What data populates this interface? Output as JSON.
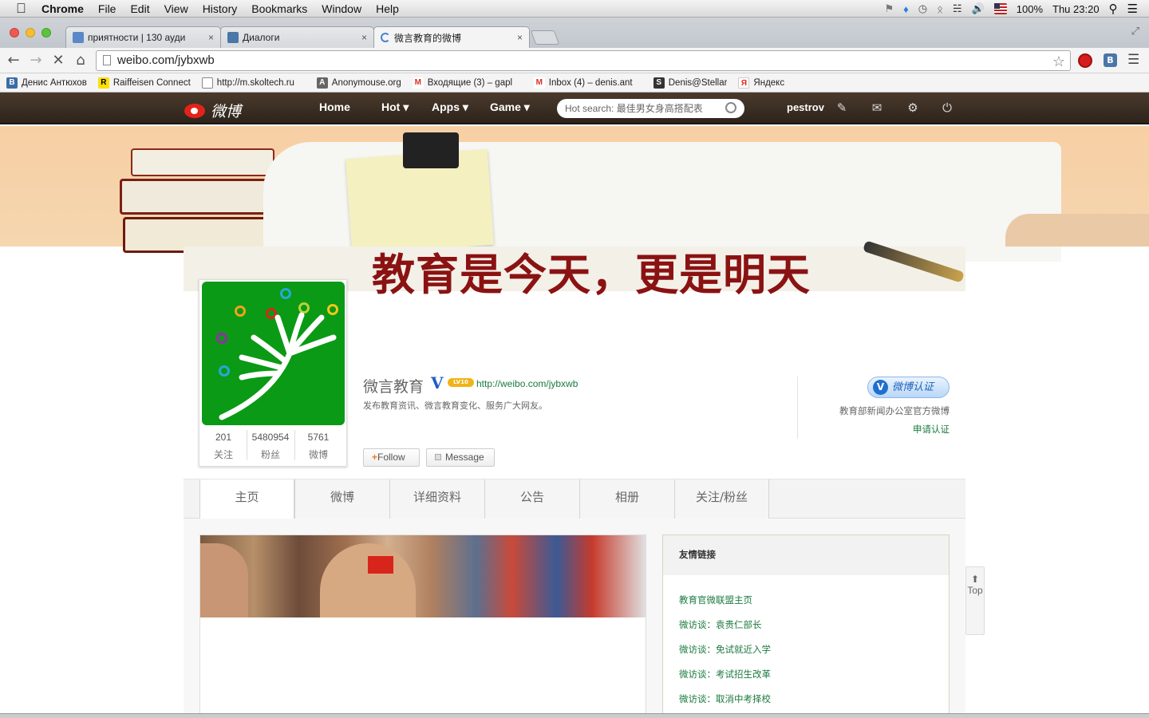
{
  "macbar": {
    "app": "Chrome",
    "menus": [
      "File",
      "Edit",
      "View",
      "History",
      "Bookmarks",
      "Window",
      "Help"
    ],
    "battery": "100%",
    "clock": "Thu 23:20"
  },
  "tabs": [
    {
      "label": "приятности | 130 ауди",
      "close": "×"
    },
    {
      "label": "Диалоги",
      "close": "×"
    },
    {
      "label": "微言教育的微博",
      "close": "×"
    }
  ],
  "address": {
    "url": "weibo.com/jybxwb"
  },
  "bookmarks": [
    {
      "label": "Денис Антюхов",
      "icon": "B",
      "color": "#3b6ea5"
    },
    {
      "label": "Raiffeisen Connect",
      "icon": "R",
      "color": "#222"
    },
    {
      "label": "http://m.skoltech.ru",
      "icon": "",
      "color": "#fff"
    },
    {
      "label": "Anonymouse.org",
      "icon": "A",
      "color": "#666"
    },
    {
      "label": "Входящие (3) – gapl",
      "icon": "M",
      "color": "#d93025"
    },
    {
      "label": "Inbox (4) – denis.ant",
      "icon": "M",
      "color": "#d93025"
    },
    {
      "label": "Denis@Stellar",
      "icon": "S",
      "color": "#333"
    },
    {
      "label": "Яндекс",
      "icon": "Я",
      "color": "#e52620"
    }
  ],
  "weibo_nav": {
    "logo": "微博",
    "items": [
      "Home",
      "Hot ▾",
      "Apps ▾",
      "Game ▾"
    ],
    "search_placeholder": "Hot search: 最佳男女身高搭配表",
    "user": "pestrov"
  },
  "banner": {
    "slogan": "教育是今天，更是明天"
  },
  "profile": {
    "name": "微言教育",
    "verified_mark": "V",
    "level": "LV10",
    "url": "http://weibo.com/jybxwb",
    "description": "发布教育资讯、微言教育变化、服务广大网友。",
    "stats": [
      {
        "value": "201",
        "label": "关注"
      },
      {
        "value": "5480954",
        "label": "粉丝"
      },
      {
        "value": "5761",
        "label": "微博"
      }
    ],
    "follow_label": "Follow",
    "message_label": "Message",
    "verify_badge": "微博认证",
    "verify_desc": "教育部新闻办公室官方微博",
    "verify_apply": "申请认证"
  },
  "profile_tabs": [
    "主页",
    "微博",
    "详细资料",
    "公告",
    "相册",
    "关注/粉丝"
  ],
  "links": {
    "title": "友情链接",
    "items": [
      "教育官微联盟主页",
      "微访谈：袁贵仁部长",
      "微访谈：免试就近入学",
      "微访谈：考试招生改革",
      "微访谈：取消中考择校"
    ]
  },
  "top_button": "Top"
}
